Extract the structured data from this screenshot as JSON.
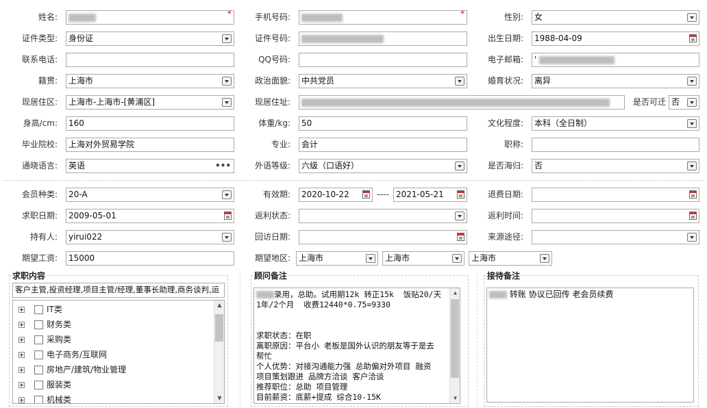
{
  "personal": {
    "name_label": "姓名:",
    "phone_label": "手机号码:",
    "gender_label": "性别:",
    "gender_value": "女",
    "id_type_label": "证件类型:",
    "id_type_value": "身份证",
    "id_no_label": "证件号码:",
    "birth_label": "出生日期:",
    "birth_value": "1988-04-09",
    "tel_label": "联系电话:",
    "qq_label": "QQ号码:",
    "email_label": "电子邮箱:",
    "email_prefix": "'",
    "native_label": "籍贯:",
    "native_value": "上海市",
    "political_label": "政治面貌:",
    "political_value": "中共党员",
    "marital_label": "婚育状况:",
    "marital_value": "离异",
    "residence_label": "现居住区:",
    "residence_value": "上海市-上海市-[黄浦区]",
    "address_label": "现居住址:",
    "relocate_label": "是否可迁",
    "relocate_value": "否",
    "height_label": "身高/cm:",
    "height_value": "160",
    "weight_label": "体重/kg:",
    "weight_value": "50",
    "education_label": "文化程度:",
    "education_value": "本科（全日制）",
    "school_label": "毕业院校:",
    "school_value": "上海对外贸易学院",
    "major_label": "专业:",
    "major_value": "会计",
    "title_label": "职称:",
    "lang_label": "通晓语言:",
    "lang_value": "英语",
    "lang_more": "•••",
    "foreign_label": "外语等级:",
    "foreign_value": "六级（口语好）",
    "overseas_label": "是否海归:",
    "overseas_value": "否"
  },
  "membership": {
    "type_label": "会员种类:",
    "type_value": "20-A",
    "valid_label": "有效期:",
    "valid_from": "2020-10-22",
    "valid_sep": "----",
    "valid_to": "2021-05-21",
    "refund_date_label": "退费日期:",
    "job_date_label": "求职日期:",
    "job_date_value": "2009-05-01",
    "rebate_status_label": "返利状态:",
    "rebate_time_label": "返利时间:",
    "holder_label": "持有人:",
    "holder_value": "yirui022",
    "visit_label": "回访日期:",
    "source_label": "来源途径:",
    "salary_label": "期望工资:",
    "salary_value": "15000",
    "region_label": "期望地区:",
    "region_1": "上海市",
    "region_2": "上海市",
    "region_3": "上海市"
  },
  "job": {
    "title": "求职内容",
    "summary": "客户主管,投资经理,项目主管/经理,董事长助理,商务谈判,运",
    "categories": [
      "IT类",
      "财务类",
      "采购类",
      "电子商务/互联网",
      "房地产/建筑/物业管理",
      "服装类",
      "机械类"
    ]
  },
  "consultant": {
    "title": "顾问备注",
    "lines": [
      "录用，总助。试用期12k 转正15k  饭贴20/天",
      "1年/2个月  收费12440*0.75=9330",
      "",
      "",
      "求职状态：在职",
      "离职原因：平台小 老板是国外认识的朋友等于是去",
      "帮忙",
      "个人优势：对接沟通能力强 总助偏对外项目 融资",
      "项目策划跟进 品牌方洽谈 客户洽谈",
      "推荐职位：总助 项目管理",
      "目前薪资：底薪+提成 综合10-15K"
    ]
  },
  "reception": {
    "title": "接待备注",
    "text": "转账 协议已回传  老会员续费"
  },
  "colors": {
    "required": "#e00000",
    "border": "#a9a9a9",
    "label": "#333333"
  }
}
